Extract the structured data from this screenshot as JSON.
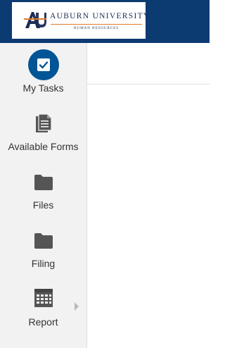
{
  "header": {
    "logo": {
      "name": "AUBURN UNIVERSITY",
      "department": "HUMAN RESOURCES",
      "colors": {
        "navy": "#1c2d55",
        "orange": "#e07a2a"
      }
    },
    "background_color": "#0c3b72"
  },
  "sidebar": {
    "items": [
      {
        "label": "My Tasks",
        "icon": "checkbox-check-icon"
      },
      {
        "label": "Available Forms",
        "icon": "documents-icon"
      },
      {
        "label": "Files",
        "icon": "folder-icon"
      },
      {
        "label": "Filing",
        "icon": "folder-icon"
      },
      {
        "label": "Report",
        "icon": "calendar-grid-icon",
        "expandable": true
      }
    ],
    "accent_color": "#005596"
  }
}
